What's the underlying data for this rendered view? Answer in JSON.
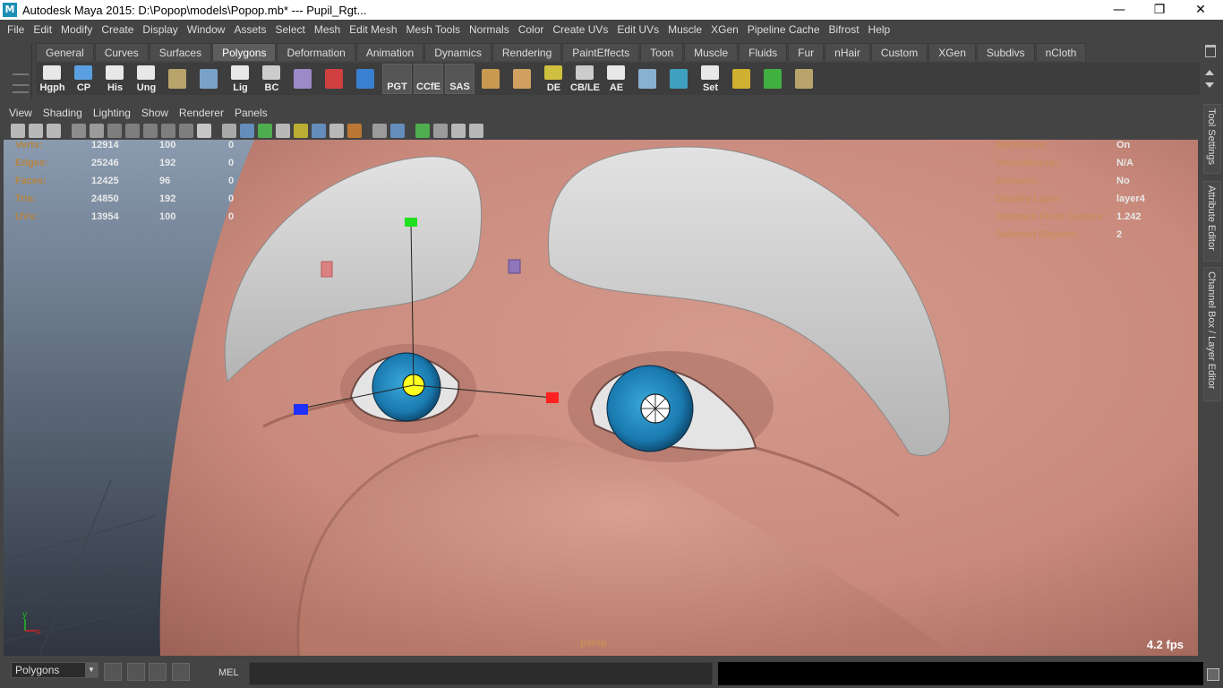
{
  "window": {
    "app_icon": "M",
    "title": "Autodesk Maya 2015: D:\\Popop\\models\\Popop.mb*   ---   Pupil_Rgt...",
    "minimize": "—",
    "restore": "❐",
    "close": "✕"
  },
  "menubar": [
    "File",
    "Edit",
    "Modify",
    "Create",
    "Display",
    "Window",
    "Assets",
    "Select",
    "Mesh",
    "Edit Mesh",
    "Mesh Tools",
    "Normals",
    "Color",
    "Create UVs",
    "Edit UVs",
    "Muscle",
    "XGen",
    "Pipeline Cache",
    "Bifrost",
    "Help"
  ],
  "shelf": {
    "tabs": [
      "General",
      "Curves",
      "Surfaces",
      "Polygons",
      "Deformation",
      "Animation",
      "Dynamics",
      "Rendering",
      "PaintEffects",
      "Toon",
      "Muscle",
      "Fluids",
      "Fur",
      "nHair",
      "Custom",
      "XGen",
      "Subdivs",
      "nCloth"
    ],
    "active_tab": "Polygons",
    "icons": [
      {
        "label": "Hgph",
        "icon": "hypergraph-icon",
        "color": "#e8e8e8"
      },
      {
        "label": "CP",
        "icon": "center-pivot-icon",
        "color": "#5aa0e0"
      },
      {
        "label": "His",
        "icon": "delete-history-icon",
        "color": "#e8e8e8"
      },
      {
        "label": "Ung",
        "icon": "ungroup-icon",
        "color": "#e8e8e8"
      },
      {
        "label": "",
        "icon": "shelf-book-icon",
        "color": "#b8a46a"
      },
      {
        "label": "",
        "icon": "globe-icon",
        "color": "#7aa2c8"
      },
      {
        "label": "Lig",
        "icon": "lighting-icon",
        "color": "#e8e8e8"
      },
      {
        "label": "BC",
        "icon": "eye-bc-icon",
        "color": "#cccccc"
      },
      {
        "label": "",
        "icon": "joint-tool-icon",
        "color": "#9a8ac8"
      },
      {
        "label": "",
        "icon": "ik-handle-icon",
        "color": "#d04040"
      },
      {
        "label": "",
        "icon": "curve-tool-icon",
        "color": "#3a80d0"
      },
      {
        "label": "PGT",
        "icon": "",
        "color": ""
      },
      {
        "label": "CCfE",
        "icon": "",
        "color": ""
      },
      {
        "label": "SAS",
        "icon": "",
        "color": ""
      },
      {
        "label": "",
        "icon": "uv-editor-icon",
        "color": "#c89a50"
      },
      {
        "label": "",
        "icon": "uv-layout-icon",
        "color": "#d0a060"
      },
      {
        "label": "DE",
        "icon": "dope-editor-icon",
        "color": "#d0c040"
      },
      {
        "label": "CB/LE",
        "icon": "channel-box-icon",
        "color": "#cccccc"
      },
      {
        "label": "AE",
        "icon": "attribute-editor-icon",
        "color": "#e8e8e8"
      },
      {
        "label": "",
        "icon": "brush-icon",
        "color": "#8ab0d0"
      },
      {
        "label": "",
        "icon": "connect-icon",
        "color": "#40a0c0"
      },
      {
        "label": "Set",
        "icon": "set-icon",
        "color": "#e8e8e8"
      },
      {
        "label": "",
        "icon": "target-icon",
        "color": "#d0b030"
      },
      {
        "label": "",
        "icon": "rotate-manip-icon",
        "color": "#40b040"
      },
      {
        "label": "",
        "icon": "shelf-book-icon",
        "color": "#b8a46a"
      }
    ]
  },
  "panel": {
    "menus": [
      "View",
      "Shading",
      "Lighting",
      "Show",
      "Renderer",
      "Panels"
    ],
    "tool_icons": [
      "camera-icon",
      "camera-attributes-icon",
      "bookmark-icon",
      "image-plane-icon",
      "grid-icon",
      "film-gate-icon",
      "resolution-gate-icon",
      "gate-mask-icon",
      "field-chart-icon",
      "safe-action-icon",
      "text-icon",
      "wireframe-icon",
      "smooth-shade-icon",
      "wireframe-on-shaded-icon",
      "textured-icon",
      "lights-icon",
      "shadows-icon",
      "ao-icon",
      "motion-blur-icon",
      "anti-alias-icon",
      "isolate-select-icon",
      "xray-icon",
      "xray-joints-icon",
      "backface-icon",
      "select-camera-icon"
    ],
    "tool_colors": [
      "#cccccc",
      "#cccccc",
      "#cccccc",
      "#999999",
      "#aaaaaa",
      "#888888",
      "#888888",
      "#888888",
      "#888888",
      "#888888",
      "#dddddd",
      "#bbbbbb",
      "#6a9ad0",
      "#50c050",
      "#cccccc",
      "#d0c030",
      "#6a9ad0",
      "#cccccc",
      "#d08030",
      "#aaaaaa",
      "#6a9ad0",
      "#50c050",
      "#aaaaaa",
      "#cccccc",
      "#cccccc"
    ]
  },
  "viewport": {
    "hud_left": [
      {
        "label": "Verts:",
        "total": "12914",
        "sel": "100",
        "comp": "0"
      },
      {
        "label": "Edges:",
        "total": "25246",
        "sel": "192",
        "comp": "0"
      },
      {
        "label": "Faces:",
        "total": "12425",
        "sel": "96",
        "comp": "0"
      },
      {
        "label": "Tris:",
        "total": "24850",
        "sel": "192",
        "comp": "0"
      },
      {
        "label": "UVs:",
        "total": "13954",
        "sel": "100",
        "comp": "0"
      }
    ],
    "hud_right": [
      {
        "label": "Backfaces:",
        "value": "On"
      },
      {
        "label": "Smoothness:",
        "value": "N/A"
      },
      {
        "label": "Instance:",
        "value": "No"
      },
      {
        "label": "Display Layer:",
        "value": "layer4"
      },
      {
        "label": "Distance From Camera:",
        "value": "1.242"
      },
      {
        "label": "Selected Objects:",
        "value": "2"
      }
    ],
    "camera": "persp",
    "fps": "4.2 fps",
    "axis_x": "x",
    "axis_y": "y",
    "skin_color": "#c98a7c",
    "brow_color": "#d6d6d6",
    "iris_color": "#1a7ab0",
    "manip_colors": {
      "x": "#ff2020",
      "y": "#20e020",
      "z": "#2030ff",
      "center": "#ffff20"
    }
  },
  "side_tabs": [
    "Tool Settings",
    "Attribute Editor",
    "Channel Box / Layer Editor"
  ],
  "command_line": {
    "mode": "Polygons",
    "mel_label": "MEL",
    "input_value": "",
    "result": ""
  }
}
